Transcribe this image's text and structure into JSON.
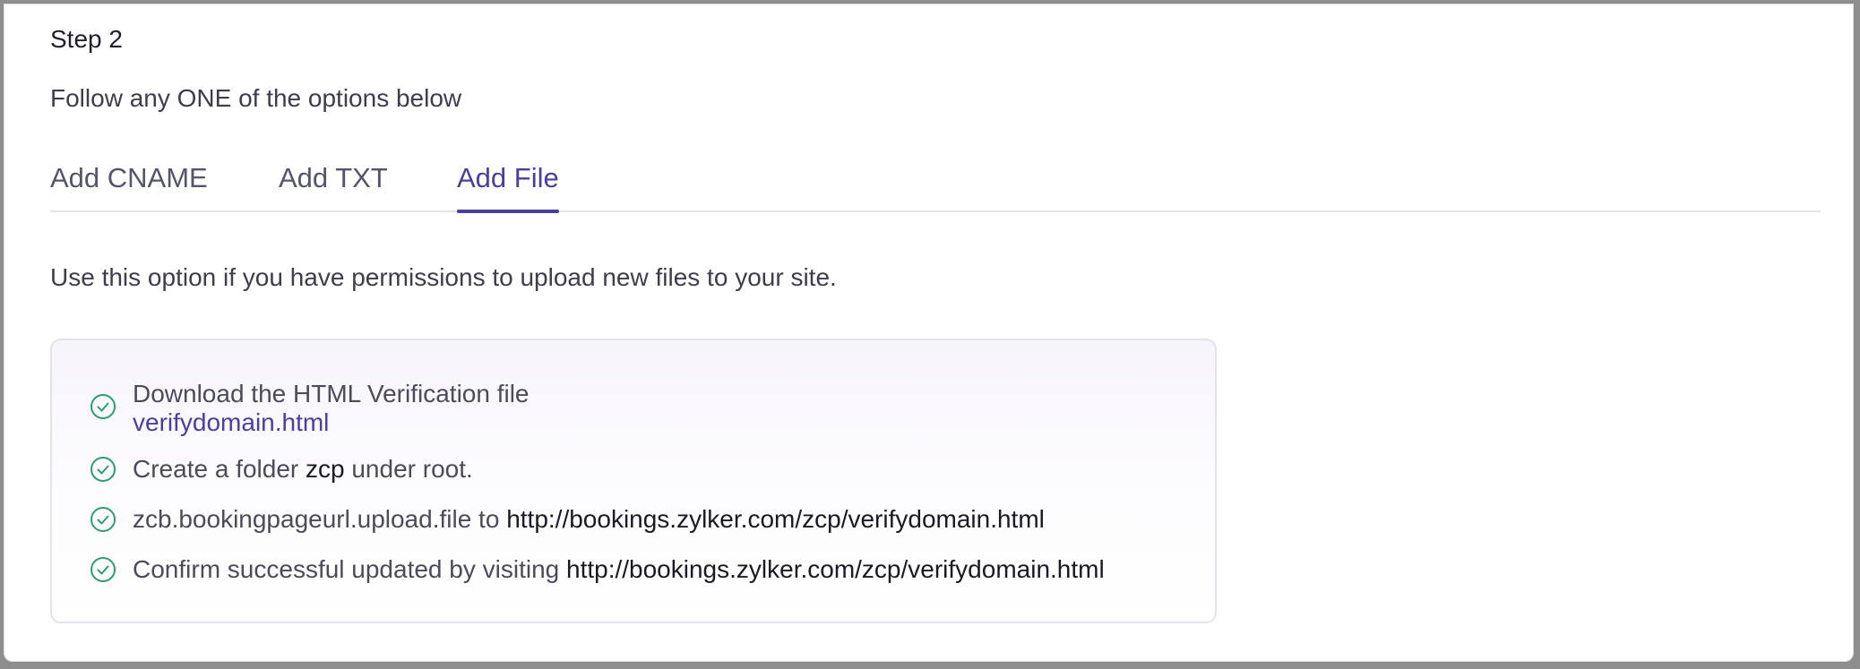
{
  "step": {
    "title": "Step 2",
    "subtitle": "Follow any ONE of the options below"
  },
  "tabs": [
    {
      "label": "Add CNAME",
      "active": false
    },
    {
      "label": "Add TXT",
      "active": false
    },
    {
      "label": "Add File",
      "active": true
    }
  ],
  "description": "Use this option if you have permissions to upload new files to your site.",
  "instructions": {
    "download_text": "Download the HTML Verification file",
    "download_link": "verifydomain.html",
    "create_folder_prefix": "Create a folder",
    "folder_name": "zcp",
    "create_folder_suffix": "under root.",
    "upload_prefix": "zcb.bookingpageurl.upload.file to",
    "upload_url": "http://bookings.zylker.com/zcp/verifydomain.html",
    "confirm_prefix": "Confirm successful updated by visiting",
    "confirm_url": "http://bookings.zylker.com/zcp/verifydomain.html"
  },
  "icons": {
    "step_check": "check-circle-icon"
  },
  "colors": {
    "accent": "#4b3f9e",
    "check_green": "#2e9e6c",
    "tab_underline": "#4b3f9e"
  }
}
